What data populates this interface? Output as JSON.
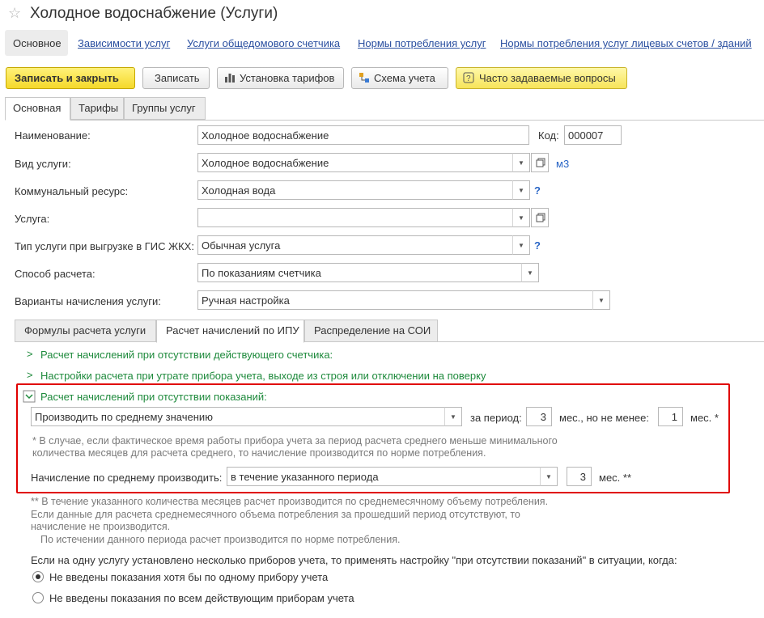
{
  "window": {
    "title": "Холодное водоснабжение (Услуги)",
    "star_icon": "star-icon"
  },
  "nav": {
    "items": [
      {
        "label": "Основное"
      },
      {
        "label": "Зависимости услуг"
      },
      {
        "label": "Услуги общедомового счетчика"
      },
      {
        "label": "Нормы потребления услуг"
      },
      {
        "label": "Нормы потребления услуг лицевых счетов / зданий"
      }
    ]
  },
  "toolbar": {
    "save_close": "Записать и закрыть",
    "save": "Записать",
    "tariffs": "Установка тарифов",
    "scheme": "Схема учета",
    "faq": "Часто задаваемые вопросы"
  },
  "tabs": [
    {
      "label": "Основная"
    },
    {
      "label": "Тарифы"
    },
    {
      "label": "Группы услуг"
    }
  ],
  "form": {
    "name_label": "Наименование:",
    "name_value": "Холодное водоснабжение",
    "code_label": "Код:",
    "code_value": "000007",
    "kind_label": "Вид услуги:",
    "kind_value": "Холодное водоснабжение",
    "kind_unit": "м3",
    "resource_label": "Коммунальный ресурс:",
    "resource_value": "Холодная вода",
    "help_mark": "?",
    "service_label": "Услуга:",
    "service_value": "",
    "gis_label": "Тип услуги при выгрузке в ГИС ЖКХ:",
    "gis_value": "Обычная услуга",
    "calc_label": "Способ расчета:",
    "calc_value": "По показаниям счетчика",
    "variants_label": "Варианты начисления услуги:",
    "variants_value": "Ручная настройка"
  },
  "inner_tabs": [
    {
      "label": "Формулы расчета услуги"
    },
    {
      "label": "Расчет начислений по ИПУ"
    },
    {
      "label": "Распределение на СОИ"
    }
  ],
  "ipu": {
    "section1": "Расчет начислений при отсутствии действующего счетчика:",
    "section2": "Настройки расчета при утрате прибора учета, выходе из строя или отключении на поверку",
    "section3": "Расчет начислений при отсутствии показаний:",
    "method_value": "Производить по среднему значению",
    "period_label": "за период:",
    "period_value": "3",
    "months_min_label": "мес., но не менее:",
    "min_value": "1",
    "months_star": "мес. *",
    "note1_line1": "* В случае, если фактическое время работы прибора учета за период расчета среднего меньше минимального",
    "note1_line2": "количества месяцев для расчета среднего, то начисление производится по норме потребления.",
    "avg_label": "Начисление по среднему производить:",
    "avg_value": "в течение указанного периода",
    "avg_months": "3",
    "months_2star": "мес. **",
    "note2_line1": "** В течение указанного количества месяцев расчет производится по среднемесячному объему потребления.",
    "note2_line2": "Если данные для расчета среднемесячного объема потребления за прошедший период отсутствуют, то",
    "note2_line3": "начисление не производится.",
    "note2_line4": "По истечении данного периода расчет производится по норме потребления.",
    "multi_label": "Если на одну услугу установлено несколько приборов учета, то применять настройку \"при отсутствии показаний\" в ситуации, когда:",
    "radio1": "Не введены показания хотя бы по одному прибору учета",
    "radio2": "Не введены показания по всем действующим приборам учета"
  },
  "colors": {
    "accent_yellow": "#f5d92a",
    "link_blue": "#2a4fa0",
    "section_green": "#1e8a3c",
    "highlight_red": "#e00000"
  }
}
